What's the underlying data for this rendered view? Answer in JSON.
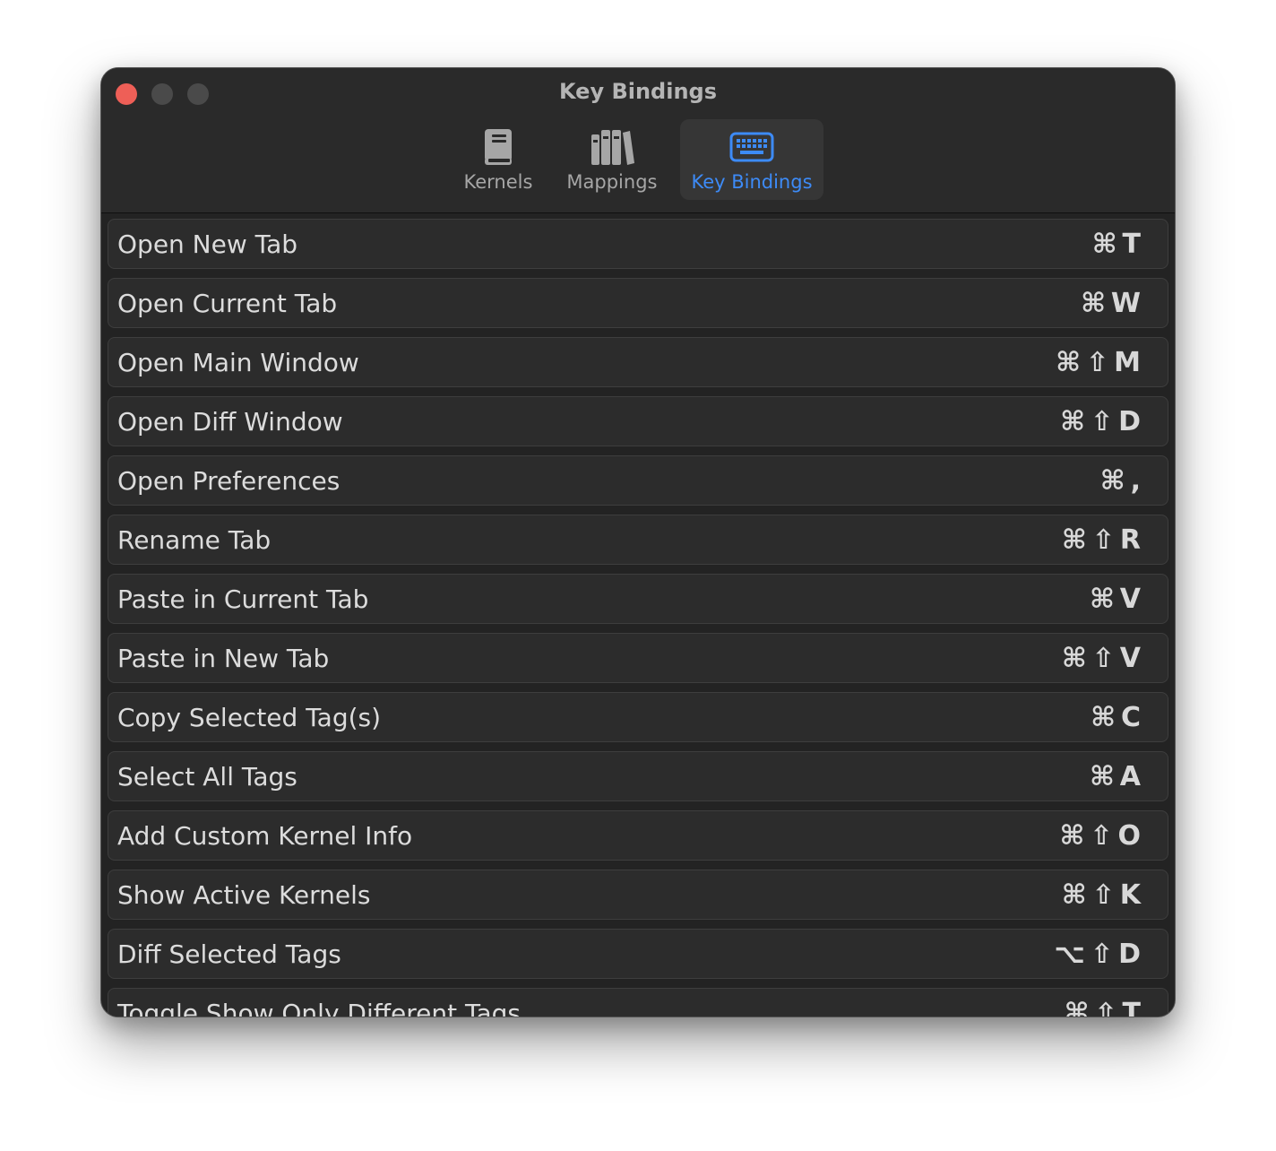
{
  "window": {
    "title": "Key Bindings"
  },
  "toolbar": {
    "tabs": [
      {
        "label": "Kernels",
        "icon": "book-icon",
        "active": false
      },
      {
        "label": "Mappings",
        "icon": "library-icon",
        "active": false
      },
      {
        "label": "Key Bindings",
        "icon": "keyboard-icon",
        "active": true
      }
    ]
  },
  "colors": {
    "accent": "#3d8bf7",
    "close": "#ee5f57",
    "window_bg": "#232323",
    "row_bg": "#2c2c2c"
  },
  "bindings": [
    {
      "label": "Open New Tab",
      "shortcut": "⌘T"
    },
    {
      "label": "Open Current Tab",
      "shortcut": "⌘W"
    },
    {
      "label": "Open Main Window",
      "shortcut": "⌘⇧M"
    },
    {
      "label": "Open Diff Window",
      "shortcut": "⌘⇧D"
    },
    {
      "label": "Open Preferences",
      "shortcut": "⌘,"
    },
    {
      "label": "Rename Tab",
      "shortcut": "⌘⇧R"
    },
    {
      "label": "Paste in Current Tab",
      "shortcut": "⌘V"
    },
    {
      "label": "Paste in New Tab",
      "shortcut": "⌘⇧V"
    },
    {
      "label": "Copy Selected Tag(s)",
      "shortcut": "⌘C"
    },
    {
      "label": "Select All Tags",
      "shortcut": "⌘A"
    },
    {
      "label": "Add Custom Kernel Info",
      "shortcut": "⌘⇧O"
    },
    {
      "label": "Show Active Kernels",
      "shortcut": "⌘⇧K"
    },
    {
      "label": "Diff Selected Tags",
      "shortcut": "⌥⇧D"
    },
    {
      "label": "Toggle Show Only Different Tags",
      "shortcut": "⌘⇧T"
    }
  ]
}
